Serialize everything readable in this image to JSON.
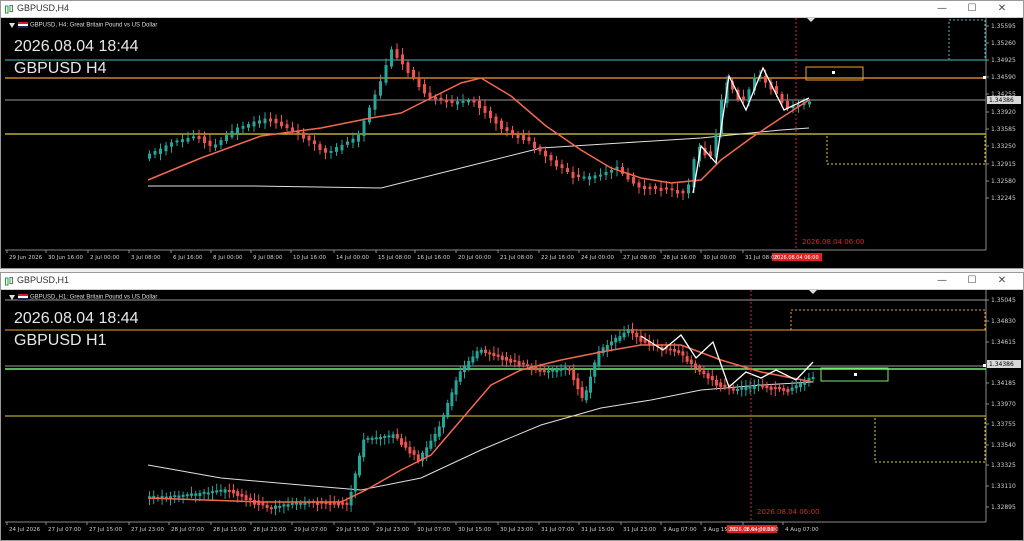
{
  "windows": [
    {
      "title": "GBPUSD,H4",
      "header": "GBPUSD, H4:  Great Britain Pound vs US Dollar",
      "overlay_date": "2026.08.04 18:44",
      "overlay_symbol": "GBPUSD H4",
      "price_labels": [
        "1.35595",
        "1.35260",
        "1.34925",
        "1.34590",
        "1.34255",
        "1.33920",
        "1.33585",
        "1.33250",
        "1.32915",
        "1.32580",
        "1.32245"
      ],
      "current_price": "1.34386",
      "time_labels": [
        "29 Jun 2026",
        "30 Jun 16:00",
        "2 Jul 00:00",
        "3 Jul 08:00",
        "6 Jul 16:00",
        "8 Jul 00:00",
        "9 Jul 08:00",
        "10 Jul 16:00",
        "14 Jul 00:00",
        "15 Jul 08:00",
        "16 Jul 16:00",
        "20 Jul 00:00",
        "21 Jul 08:00",
        "22 Jul 16:00",
        "24 Jul 00:00",
        "27 Jul 08:00",
        "28 Jul 16:00",
        "30 Jul 00:00",
        "31 Jul 08:00"
      ],
      "cursor_time_label": "2026.08.04 06:00",
      "cursor_axis_label": "2026.08.04 06:00"
    },
    {
      "title": "GBPUSD,H1",
      "header": "GBPUSD, H1:  Great Britain Pound vs US Dollar",
      "overlay_date": "2026.08.04 18:44",
      "overlay_symbol": "GBPUSD H1",
      "price_labels": [
        "1.35045",
        "1.34830",
        "1.34615",
        "1.34386",
        "1.34185",
        "1.33970",
        "1.33755",
        "1.33540",
        "1.33325",
        "1.33110",
        "1.32895"
      ],
      "current_price": "1.34386",
      "time_labels": [
        "24 Jul 2026",
        "27 Jul 07:00",
        "27 Jul 15:00",
        "27 Jul 23:00",
        "28 Jul 07:00",
        "28 Jul 15:00",
        "28 Jul 23:00",
        "29 Jul 07:00",
        "29 Jul 15:00",
        "29 Jul 23:00",
        "30 Jul 07:00",
        "30 Jul 15:00",
        "30 Jul 23:00",
        "31 Jul 07:00",
        "31 Jul 15:00",
        "31 Jul 23:00",
        "3 Aug 07:00",
        "3 Aug 15:00",
        "3 Aug 23:00",
        "4 Aug 07:00"
      ],
      "cursor_time_label": "2026.08.04 06:00",
      "cursor_axis_label": "2026.08.04 06:00"
    }
  ],
  "colors": {
    "background": "#000000",
    "bull": "#26a69a",
    "bear": "#ef5350",
    "ma_fast": "#f4684f",
    "ma_slow": "#e0e0e0",
    "zigzag": "#ffffff",
    "cursor": "#e02020",
    "level_orange": "#f0a030",
    "level_yellow": "#e0d030",
    "level_cyan": "#40c0c0",
    "level_green": "#70f070"
  },
  "icons": {
    "window": "mt-chart-icon",
    "minimize": "minimize-icon",
    "maximize": "maximize-icon",
    "close": "close-icon"
  },
  "window_buttons": {
    "minimize": "—",
    "maximize": "☐",
    "close": "✕"
  }
}
